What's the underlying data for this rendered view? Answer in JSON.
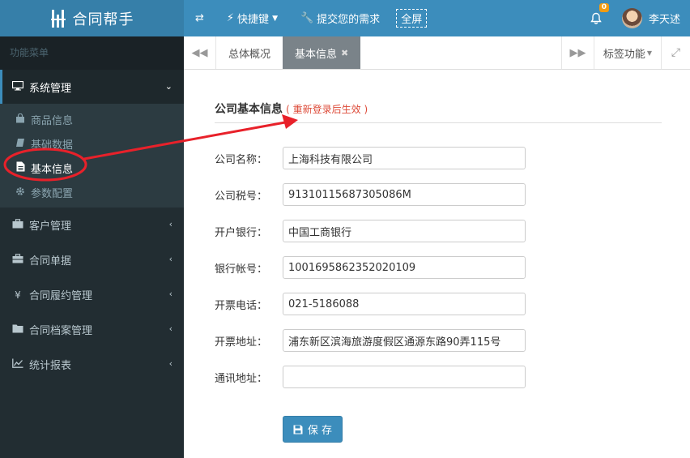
{
  "app": {
    "title": "合同帮手"
  },
  "topbar": {
    "toggle_icon": "exchange-icon",
    "shortcut_label": "快捷键",
    "request_label": "提交您的需求",
    "fullscreen_label": "全屏",
    "notification_count": "0",
    "user_name": "李天述"
  },
  "sidebar": {
    "header": "功能菜单",
    "items": [
      {
        "label": "系统管理",
        "icon": "desktop-icon",
        "open": true,
        "children": [
          {
            "label": "商品信息",
            "icon": "shopping-bag-icon"
          },
          {
            "label": "基础数据",
            "icon": "book-icon"
          },
          {
            "label": "基本信息",
            "icon": "file-icon",
            "active": true
          },
          {
            "label": "参数配置",
            "icon": "gear-icon"
          }
        ]
      },
      {
        "label": "客户管理",
        "icon": "briefcase-icon"
      },
      {
        "label": "合同单据",
        "icon": "suitcase-icon"
      },
      {
        "label": "合同履约管理",
        "icon": "yen-icon"
      },
      {
        "label": "合同档案管理",
        "icon": "folder-icon"
      },
      {
        "label": "统计报表",
        "icon": "line-chart-icon"
      }
    ]
  },
  "tabs": {
    "items": [
      {
        "label": "总体概况"
      },
      {
        "label": "基本信息",
        "active": true
      }
    ],
    "function_label": "标签功能"
  },
  "form": {
    "title": "公司基本信息",
    "note": "( 重新登录后生效 )",
    "fields": [
      {
        "label": "公司名称：",
        "value": "上海科技有限公司"
      },
      {
        "label": "公司税号：",
        "value": "91310115687305086M"
      },
      {
        "label": "开户银行：",
        "value": "中国工商银行"
      },
      {
        "label": "银行帐号：",
        "value": "1001695862352020109"
      },
      {
        "label": "开票电话：",
        "value": "021-5186088"
      },
      {
        "label": "开票地址：",
        "value": "浦东新区滨海旅游度假区通源东路90弄115号"
      },
      {
        "label": "通讯地址：",
        "value": ""
      }
    ],
    "save_label": "保 存"
  },
  "colors": {
    "primary": "#3c8dbc",
    "logo_bg": "#367fa9",
    "sidebar_bg": "#222d32",
    "annotation_red": "#e8212a",
    "note_red": "#dd4b39",
    "badge": "#f39c12"
  }
}
